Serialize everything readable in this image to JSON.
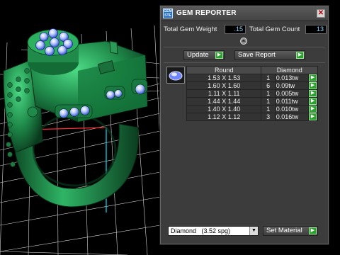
{
  "window": {
    "title": "GEM REPORTER",
    "logo_text": "GEM\nSTE",
    "close_glyph": "✕"
  },
  "stats": {
    "total_weight_label": "Total Gem Weight",
    "total_weight_value": ".15",
    "total_count_label": "Total Gem Count",
    "total_count_value": "13"
  },
  "collapse_glyph": "⏶",
  "toolbar": {
    "update_label": "Update",
    "save_report_label": "Save Report",
    "go_glyph": "▶"
  },
  "table": {
    "columns": [
      "Round",
      "Diamond"
    ],
    "rows": [
      {
        "size": "1.53 X 1.53",
        "count": "1",
        "weight": "0.013tw"
      },
      {
        "size": "1.60 X 1.60",
        "count": "6",
        "weight": "0.09tw"
      },
      {
        "size": "1.11 X 1.11",
        "count": "1",
        "weight": "0.005tw"
      },
      {
        "size": "1.44 X 1.44",
        "count": "1",
        "weight": "0.011tw"
      },
      {
        "size": "1.40 X 1.40",
        "count": "1",
        "weight": "0.010tw"
      },
      {
        "size": "1.12 X 1.12",
        "count": "3",
        "weight": "0.016tw"
      }
    ]
  },
  "material": {
    "selected": "Diamond   (3.52 spg)",
    "dropdown_glyph": "▼",
    "set_label": "Set Material"
  },
  "colors": {
    "ring_green": "#1f8a4a",
    "stone_blue": "#7a9cff",
    "grid_white": "#ffffff",
    "axis_red": "#ff2a2a",
    "axis_cyan": "#00e5ff",
    "go_green": "#2aa12a"
  }
}
